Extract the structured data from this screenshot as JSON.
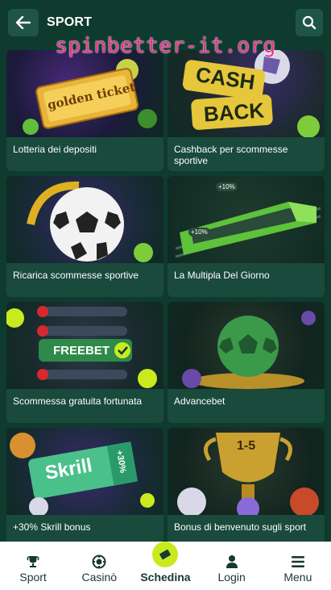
{
  "header": {
    "title": "SPORT",
    "watermark": "spinbetter-it.org"
  },
  "cards": [
    {
      "label": "Lotteria dei depositi",
      "art": "golden-ticket",
      "art_text": "golden ticket"
    },
    {
      "label": "Cashback per scommesse sportive",
      "art": "cashback",
      "art_text_1": "CASH",
      "art_text_2": "BACK"
    },
    {
      "label": "Ricarica scommesse sportive",
      "art": "soccer-ball"
    },
    {
      "label": "La Multipla Del Giorno",
      "art": "train",
      "art_text_1": "+10%",
      "art_text_2": "+10%"
    },
    {
      "label": "Scommessa gratuita fortunata",
      "art": "freebet",
      "art_text": "FREEBET"
    },
    {
      "label": "Advancebet",
      "art": "green-ball"
    },
    {
      "label": "+30% Skrill bonus",
      "art": "skrill",
      "art_text_1": "Skrill",
      "art_text_2": "+30%"
    },
    {
      "label": "Bonus di benvenuto sugli sport",
      "art": "trophy",
      "art_text": "1-5"
    }
  ],
  "nav": {
    "sport": "Sport",
    "casino": "Casinò",
    "schedina": "Schedina",
    "login": "Login",
    "menu": "Menu"
  },
  "colors": {
    "bg": "#0f3a2e",
    "card": "#194a3c",
    "accent": "#c8ea1f",
    "watermark": "#e8318a"
  }
}
